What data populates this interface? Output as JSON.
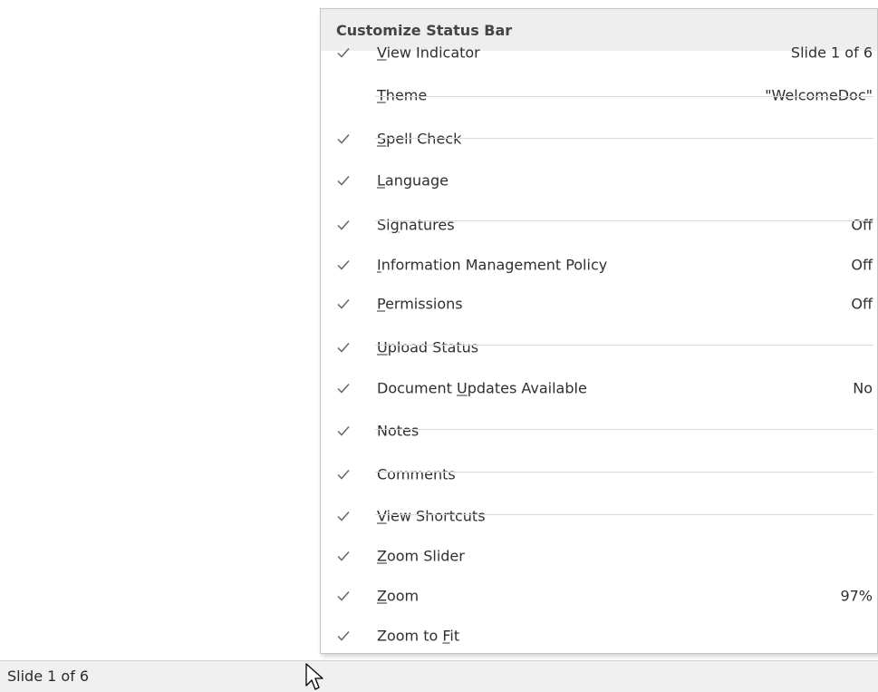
{
  "menu": {
    "title": "Customize Status Bar",
    "items": [
      {
        "checked": true,
        "pre": "",
        "u": "V",
        "post": "iew Indicator",
        "value": "Slide 1 of 6"
      },
      {
        "checked": false,
        "pre": "",
        "u": "T",
        "post": "heme",
        "value": "\"WelcomeDoc\""
      },
      {
        "checked": true,
        "pre": "",
        "u": "S",
        "post": "pell Check",
        "value": ""
      },
      {
        "checked": true,
        "pre": "",
        "u": "L",
        "post": "anguage",
        "value": ""
      },
      {
        "checked": true,
        "pre": "Si",
        "u": "g",
        "post": "natures",
        "value": "Off"
      },
      {
        "checked": true,
        "pre": "",
        "u": "I",
        "post": "nformation Management Policy",
        "value": "Off"
      },
      {
        "checked": true,
        "pre": "",
        "u": "P",
        "post": "ermissions",
        "value": "Off"
      },
      {
        "checked": true,
        "pre": "",
        "u": "U",
        "post": "pload Status",
        "value": ""
      },
      {
        "checked": true,
        "pre": "Document ",
        "u": "U",
        "post": "pdates Available",
        "value": "No"
      },
      {
        "checked": true,
        "pre": "Notes",
        "u": "",
        "post": "",
        "value": ""
      },
      {
        "checked": true,
        "pre": "Comments",
        "u": "",
        "post": "",
        "value": ""
      },
      {
        "checked": true,
        "pre": "",
        "u": "V",
        "post": "iew Shortcuts",
        "value": ""
      },
      {
        "checked": true,
        "pre": "",
        "u": "Z",
        "post": "oom Slider",
        "value": ""
      },
      {
        "checked": true,
        "pre": "",
        "u": "Z",
        "post": "oom",
        "value": "97%"
      },
      {
        "checked": true,
        "pre": "Zoom to ",
        "u": "F",
        "post": "it",
        "value": ""
      }
    ]
  },
  "status_bar": {
    "view_indicator": "Slide 1 of 6"
  },
  "colors": {
    "menu_header_bg": "#eeeeee",
    "status_bar_bg": "#f0f0f0",
    "check": "#666666"
  }
}
